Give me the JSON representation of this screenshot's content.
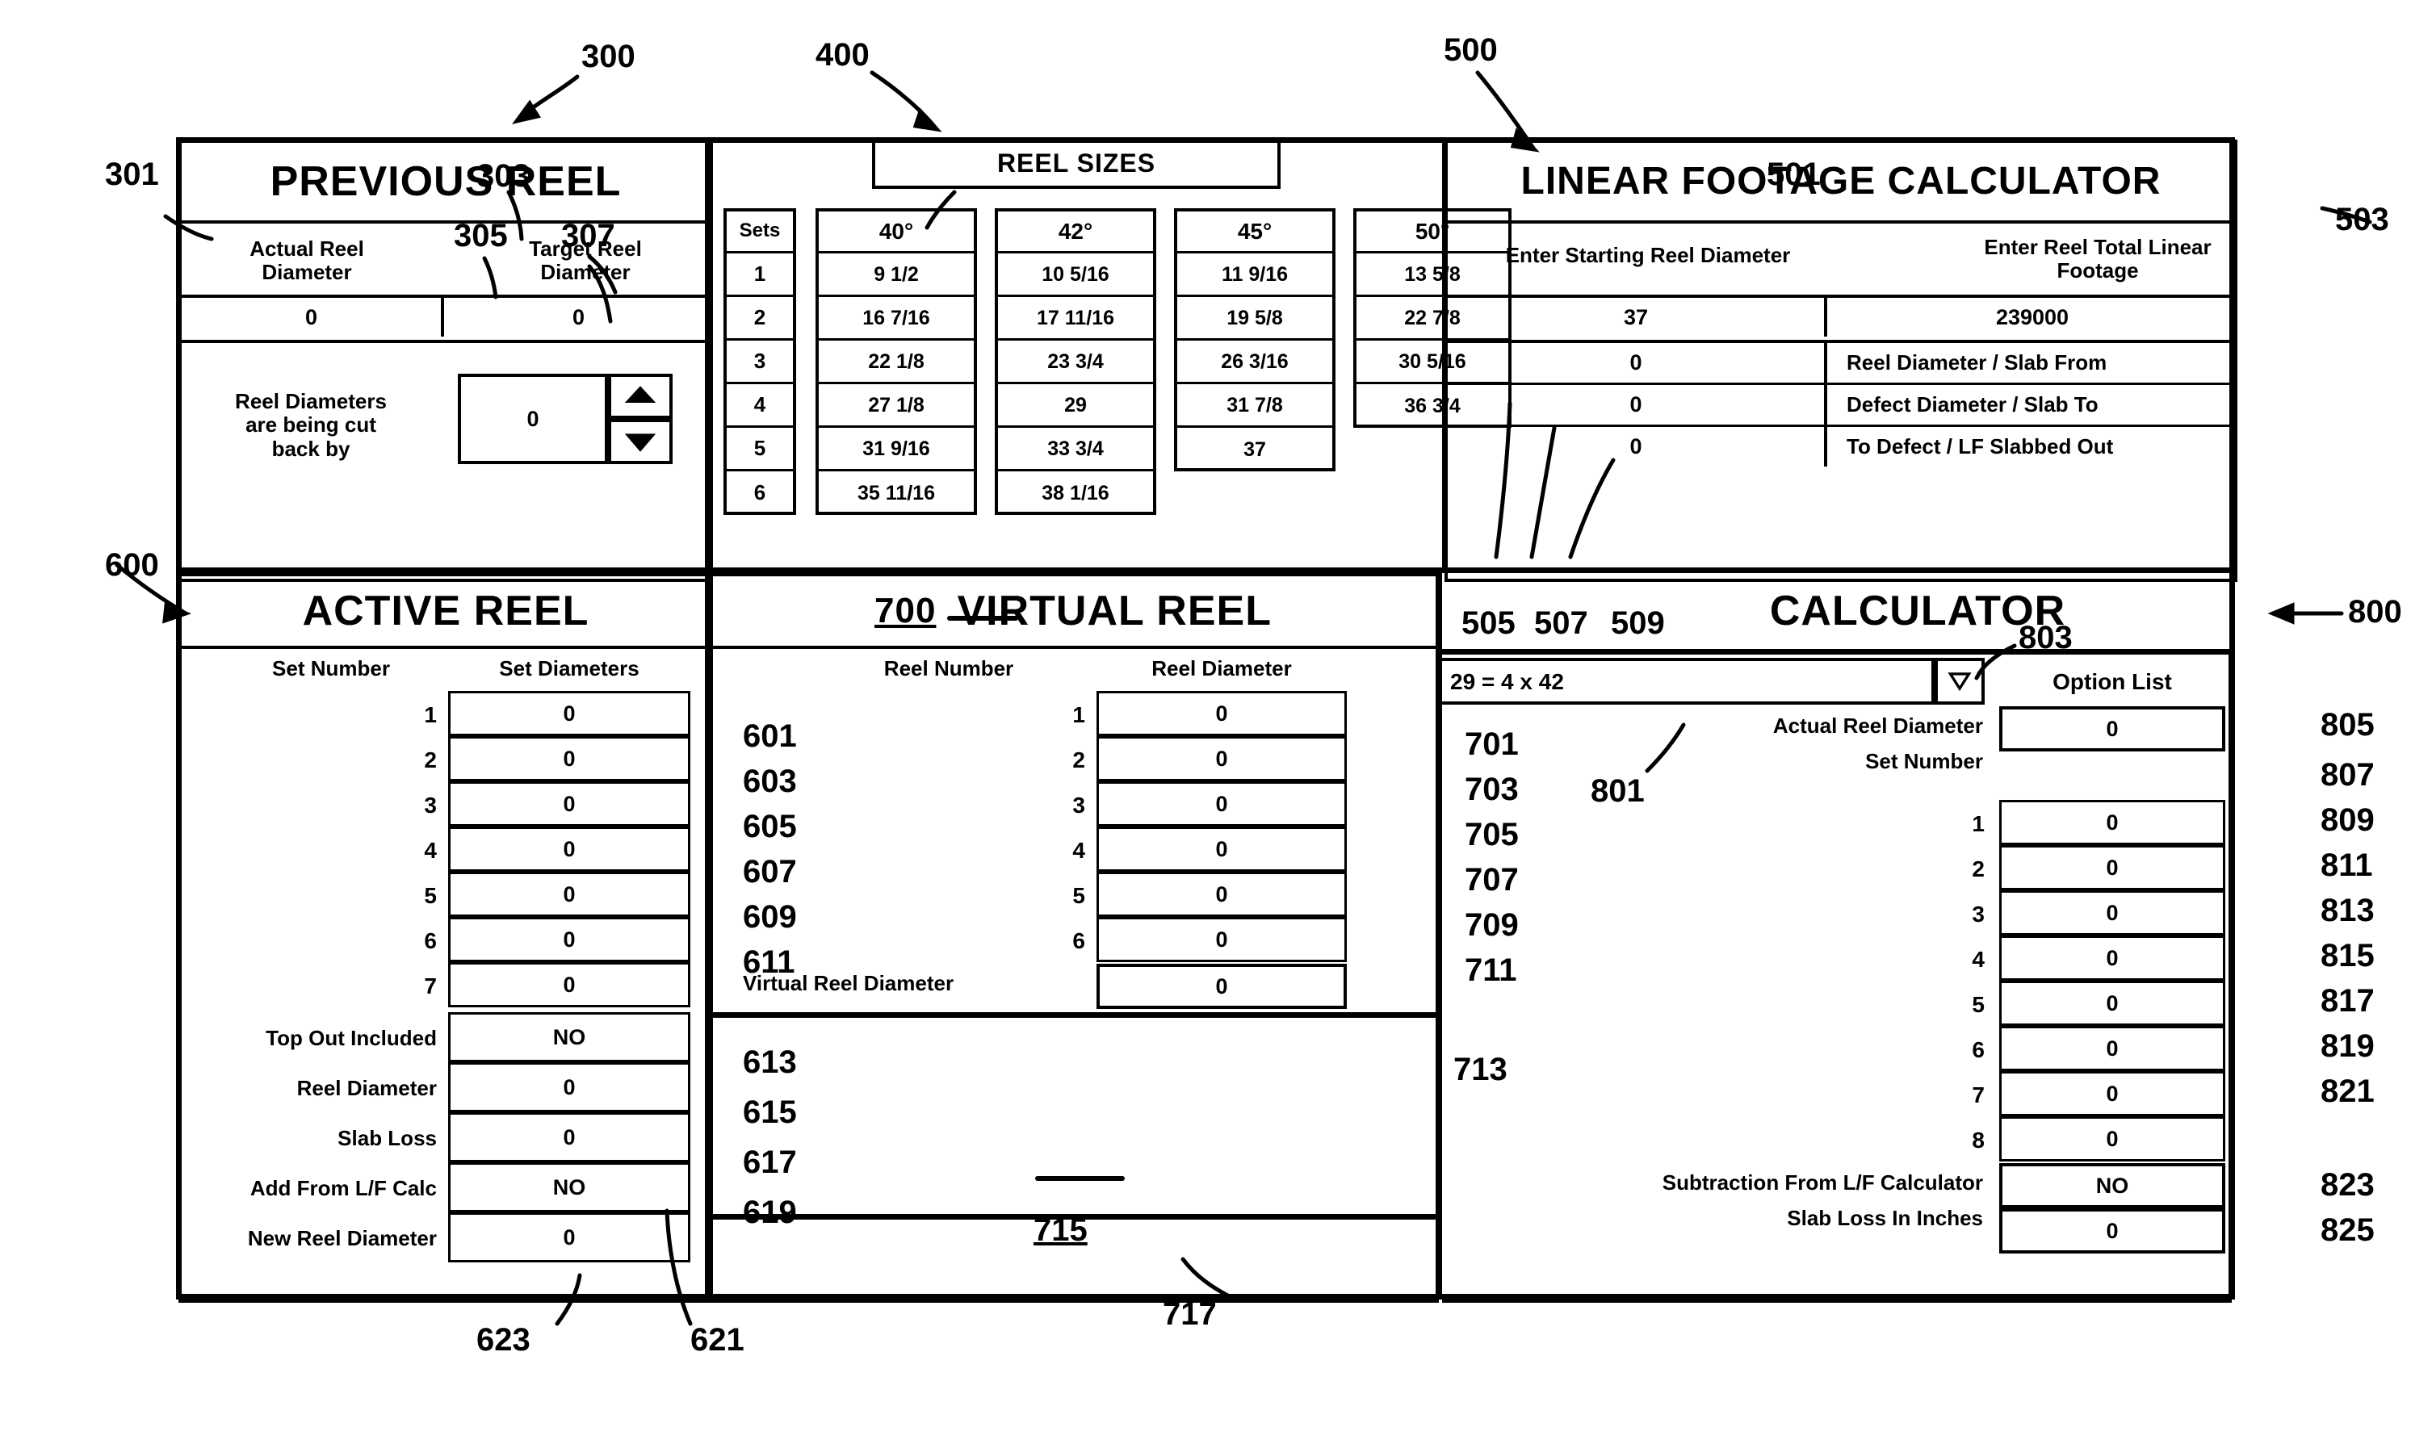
{
  "figure": {
    "panels": {
      "previous_reel": {
        "title": "PREVIOUS REEL",
        "ref": "300",
        "ref_left": "301",
        "actual_label": "Actual Reel\nDiameter",
        "actual_label_l1": "Actual Reel",
        "actual_label_l2": "Diameter",
        "target_label_l1": "Target Reel",
        "target_label_l2": "Diameter",
        "ref_mid": "303",
        "actual_value": "0",
        "target_value": "0",
        "cutback_l1": "Reel Diameters",
        "cutback_l2": "are being cut",
        "cutback_l3": "back by",
        "cutback_value": "0",
        "ref_305": "305",
        "ref_307": "307"
      },
      "reel_sizes": {
        "title": "REEL SIZES",
        "ref": "400",
        "sets_header": "Sets",
        "columns": [
          "40°",
          "42°",
          "45°",
          "50°"
        ],
        "set_numbers": [
          "1",
          "2",
          "3",
          "4",
          "5",
          "6"
        ],
        "col_40": [
          "9 1/2",
          "16 7/16",
          "22 1/8",
          "27 1/8",
          "31 9/16",
          "35 11/16"
        ],
        "col_42": [
          "10 5/16",
          "17 11/16",
          "23 3/4",
          "29",
          "33 3/4",
          "38 1/16"
        ],
        "col_45": [
          "11 9/16",
          "19 5/8",
          "26 3/16",
          "31 7/8",
          "37"
        ],
        "col_50": [
          "13 5/8",
          "22 7/8",
          "30 5/16",
          "36 3/4"
        ]
      },
      "linear_footage_calculator": {
        "title": "LINEAR FOOTAGE CALCULATOR",
        "ref": "500",
        "enter_starting_label": "Enter Starting Reel Diameter",
        "ref_501": "501",
        "enter_total_l1": "Enter Reel Total Linear",
        "enter_total_l2": "Footage",
        "starting_value": "37",
        "total_value": "239000",
        "ref_503": "503",
        "rows": [
          {
            "value": "0",
            "label": "Reel Diameter / Slab From"
          },
          {
            "value": "0",
            "label": "Defect Diameter / Slab To"
          },
          {
            "value": "0",
            "label": "To Defect / LF Slabbed Out"
          }
        ],
        "ref_505": "505",
        "ref_507": "507",
        "ref_509": "509"
      },
      "active_reel": {
        "title": "ACTIVE REEL",
        "ref": "600",
        "set_number_header": "Set Number",
        "set_diameters_header": "Set Diameters",
        "set_rows": [
          {
            "n": "1",
            "value": "0",
            "ref": "601"
          },
          {
            "n": "2",
            "value": "0",
            "ref": "603"
          },
          {
            "n": "3",
            "value": "0",
            "ref": "605"
          },
          {
            "n": "4",
            "value": "0",
            "ref": "607"
          },
          {
            "n": "5",
            "value": "0",
            "ref": "609"
          },
          {
            "n": "6",
            "value": "0",
            "ref": "611"
          },
          {
            "n": "7",
            "value": "0",
            "ref": ""
          }
        ],
        "summary_rows": [
          {
            "label": "Top Out Included",
            "value": "NO",
            "ref": "613"
          },
          {
            "label": "Reel Diameter",
            "value": "0",
            "ref": "615"
          },
          {
            "label": "Slab Loss",
            "value": "0",
            "ref": "617"
          },
          {
            "label": "Add From L/F Calc",
            "value": "NO",
            "ref": "619"
          },
          {
            "label": "New Reel Diameter",
            "value": "0",
            "ref": ""
          }
        ],
        "ref_621": "621",
        "ref_623": "623"
      },
      "virtual_reel": {
        "title": "VIRTUAL REEL",
        "ref": "700",
        "reel_number_header": "Reel Number",
        "reel_diameter_header": "Reel Diameter",
        "rows": [
          {
            "n": "1",
            "value": "0",
            "ref": "701"
          },
          {
            "n": "2",
            "value": "0",
            "ref": "703"
          },
          {
            "n": "3",
            "value": "0",
            "ref": "705"
          },
          {
            "n": "4",
            "value": "0",
            "ref": "707"
          },
          {
            "n": "5",
            "value": "0",
            "ref": "709"
          },
          {
            "n": "6",
            "value": "0",
            "ref": "711"
          }
        ],
        "virtual_diameter_label": "Virtual Reel Diameter",
        "virtual_diameter_value": "0",
        "ref_713": "713",
        "ref_715": "715",
        "ref_717": "717"
      },
      "calculator": {
        "title": "CALCULATOR",
        "ref": "800",
        "dropdown_value": "29 = 4 x 42",
        "dropdown_arrow": "chevron-down-icon",
        "ref_801": "801",
        "ref_803": "803",
        "option_list_header": "Option List",
        "actual_reel_diameter_label": "Actual Reel Diameter",
        "set_number_label": "Set Number",
        "actual_reel_diameter_value": "0",
        "ref_805": "805",
        "set_rows": [
          {
            "n": "1",
            "value": "0",
            "ref": "807"
          },
          {
            "n": "2",
            "value": "0",
            "ref": "809"
          },
          {
            "n": "3",
            "value": "0",
            "ref": "811"
          },
          {
            "n": "4",
            "value": "0",
            "ref": "813"
          },
          {
            "n": "5",
            "value": "0",
            "ref": "815"
          },
          {
            "n": "6",
            "value": "0",
            "ref": "817"
          },
          {
            "n": "7",
            "value": "0",
            "ref": "819"
          },
          {
            "n": "8",
            "value": "0",
            "ref": "821"
          }
        ],
        "subtraction_label": "Subtraction From L/F Calculator",
        "slab_loss_label": "Slab Loss In Inches",
        "subtraction_value": "NO",
        "slab_loss_value": "0",
        "ref_823": "823",
        "ref_825": "825"
      }
    }
  }
}
